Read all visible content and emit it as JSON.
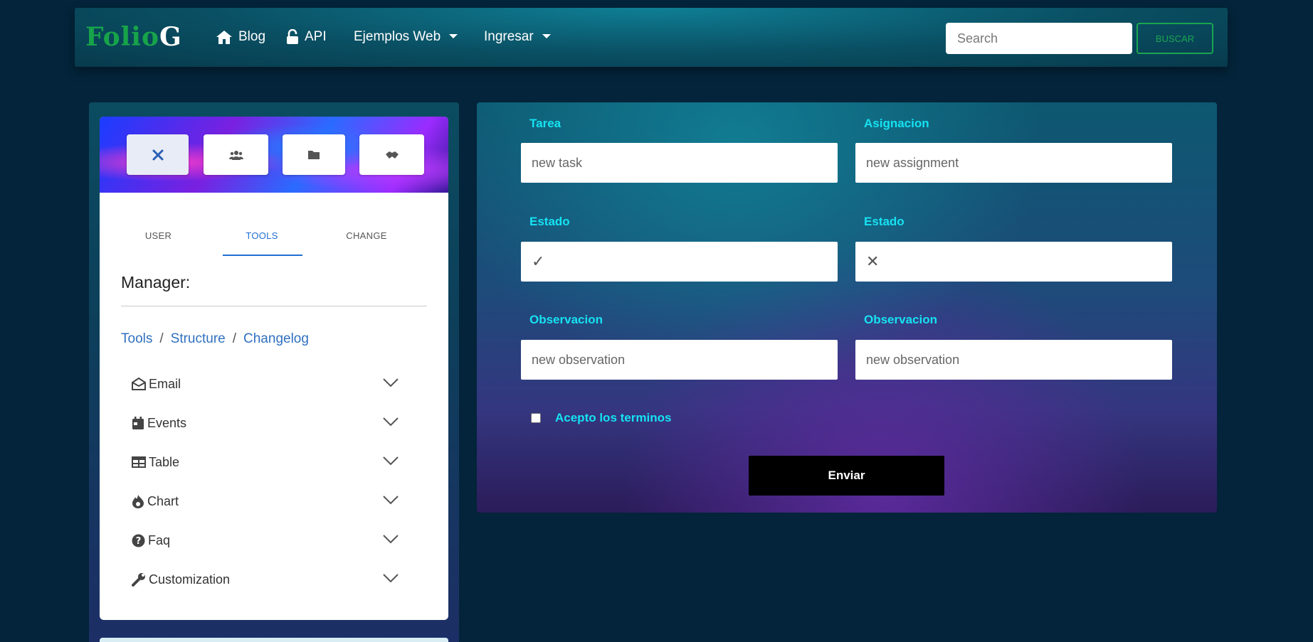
{
  "navbar": {
    "brand_part1": "Folio",
    "brand_part2": "G",
    "items": [
      {
        "label": "Blog",
        "icon": "home-icon"
      },
      {
        "label": "API",
        "icon": "unlock-icon"
      },
      {
        "label": "Ejemplos Web",
        "icon": "caret-down-icon"
      },
      {
        "label": "Ingresar",
        "icon": "caret-down-icon"
      }
    ],
    "search_placeholder": "Search",
    "search_button": "BUSCAR"
  },
  "sidebar": {
    "banner_buttons": [
      "tools-icon",
      "users-icon",
      "folder-icon",
      "handshake-icon"
    ],
    "tabs": [
      {
        "label": "USER",
        "active": false
      },
      {
        "label": "TOOLS",
        "active": true
      },
      {
        "label": "CHANGE",
        "active": false
      }
    ],
    "manager_title": "Manager:",
    "breadcrumb": [
      "Tools",
      "Structure",
      "Changelog"
    ],
    "accordion": [
      {
        "label": "Email",
        "icon": "envelope-open-icon"
      },
      {
        "label": "Events",
        "icon": "calendar-icon"
      },
      {
        "label": "Table",
        "icon": "table-icon"
      },
      {
        "label": "Chart",
        "icon": "fire-icon"
      },
      {
        "label": "Faq",
        "icon": "question-circle-icon"
      },
      {
        "label": "Customization",
        "icon": "wrench-icon"
      }
    ]
  },
  "form": {
    "tarea_label": "Tarea",
    "tarea_placeholder": "new task",
    "asignacion_label": "Asignacion",
    "asignacion_placeholder": "new assignment",
    "estado1_label": "Estado",
    "estado1_value": "✓",
    "estado2_label": "Estado",
    "estado2_value": "✕",
    "obs1_label": "Observacion",
    "obs1_placeholder": "new observation",
    "obs2_label": "Observacion",
    "obs2_placeholder": "new observation",
    "terms_label": "Acepto los terminos",
    "submit_label": "Enviar"
  },
  "colors": {
    "background": "#03243a",
    "label_cyan": "#16e2f2",
    "brand_green": "#17a34a",
    "link_blue": "#1f6fd0"
  }
}
